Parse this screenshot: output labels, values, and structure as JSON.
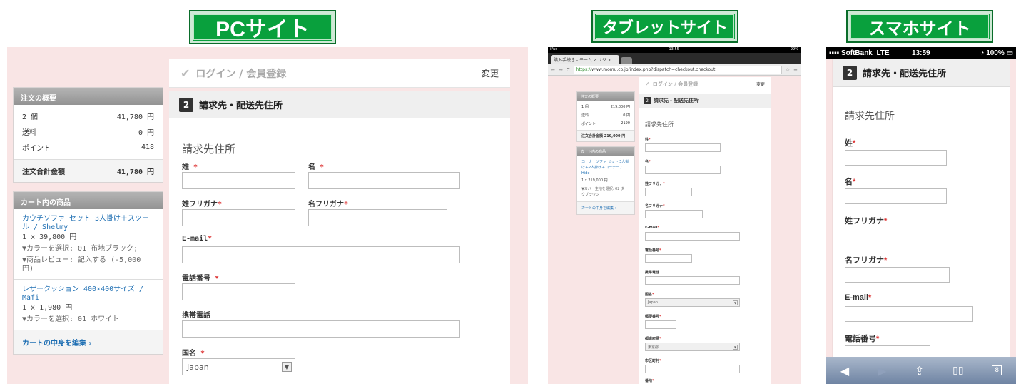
{
  "headers": {
    "pc": "PCサイト",
    "tablet": "タブレットサイト",
    "smartphone": "スマホサイト"
  },
  "pc": {
    "step1": {
      "title": "ログイン / 会員登録",
      "change": "変更"
    },
    "step2": {
      "num": "2",
      "title": "請求先・配送先住所"
    },
    "form_title": "請求先住所",
    "fields": {
      "sei": "姓",
      "mei": "名",
      "sei_kana": "姓フリガナ",
      "mei_kana": "名フリガナ",
      "email": "E-mail",
      "tel": "電話番号",
      "mobile": "携帯電話",
      "country": "国名",
      "country_value": "Japan",
      "required_mark": "*"
    },
    "summary": {
      "title": "注文の概要",
      "rows": [
        {
          "label": "2 個",
          "value": "41,780 円"
        },
        {
          "label": "送料",
          "value": "0 円"
        },
        {
          "label": "ポイント",
          "value": "418"
        }
      ],
      "total_label": "注文合計金額",
      "total_value": "41,780 円"
    },
    "cart": {
      "title": "カート内の商品",
      "items": [
        {
          "name": "カウチソファ セット 3人掛け＋スツール / Shelmy",
          "price": "1 x 39,800 円",
          "opt1": "▼カラーを選択: 01 布地ブラック;",
          "opt2": "▼商品レビュー: 記入する (-5,000 円)"
        },
        {
          "name": "レザークッション 400×400サイズ / Mafi",
          "price": "1 x 1,980 円",
          "opt1": "▼カラーを選択: 01 ホワイト"
        }
      ],
      "edit": "カートの中身を編集 ›"
    }
  },
  "tablet": {
    "status": {
      "left": "iPad",
      "time": "13:55",
      "battery": "99%"
    },
    "tab_title": "購入手続き - モーム オリジ",
    "url_https": "https://",
    "url_rest": "www.momu.co.jp/index.php?dispatch=checkout.checkout",
    "step1": {
      "title": "ログイン / 会員登録",
      "change": "変更"
    },
    "step2": {
      "num": "2",
      "title": "請求先・配送先住所"
    },
    "form_title": "請求先住所",
    "fields": {
      "sei": "姓",
      "mei": "名",
      "sei_kana": "姓フリガナ",
      "mei_kana": "名フリガナ",
      "email": "E-mail",
      "tel": "電話番号",
      "mobile": "携帯電話",
      "country": "国名",
      "country_value": "Japan",
      "zip": "郵便番号",
      "pref": "都道府県",
      "pref_value": "東京都",
      "city": "市区町村",
      "addr": "番地",
      "required_mark": "*"
    },
    "summary": {
      "title": "注文の概要",
      "rows": [
        {
          "label": "1 個",
          "value": "219,000 円"
        },
        {
          "label": "送料",
          "value": "0 円"
        },
        {
          "label": "ポイント",
          "value": "2190"
        }
      ],
      "total": "注文合計金額 219,000 円"
    },
    "cart": {
      "title": "カート内の商品",
      "item_name": "コーナーソファ セット 3人掛け＋2人掛け＋コーナー / Hide",
      "item_price": "1 x 219,000 円",
      "item_opt": "▼カバー生地を選択: 02 ダークブラウン",
      "edit": "カートの中身を編集 ›"
    }
  },
  "smartphone": {
    "status": {
      "carrier": "SoftBank",
      "network": "LTE",
      "time": "13:59",
      "battery": "100%"
    },
    "step2": {
      "num": "2",
      "title": "請求先・配送先住所"
    },
    "form_title": "請求先住所",
    "fields": {
      "sei": "姓",
      "mei": "名",
      "sei_kana": "姓フリガナ",
      "mei_kana": "名フリガナ",
      "email": "E-mail",
      "tel": "電話番号",
      "required_mark": "*"
    },
    "toolbar": {
      "back": "◀",
      "forward": "▶",
      "share": "⇪",
      "bookmarks": "📖",
      "tabs": "8"
    }
  },
  "colors": {
    "accent_green": "#09a03d",
    "bg_pink": "#f9e5e5",
    "link_blue": "#1f6fb3"
  }
}
